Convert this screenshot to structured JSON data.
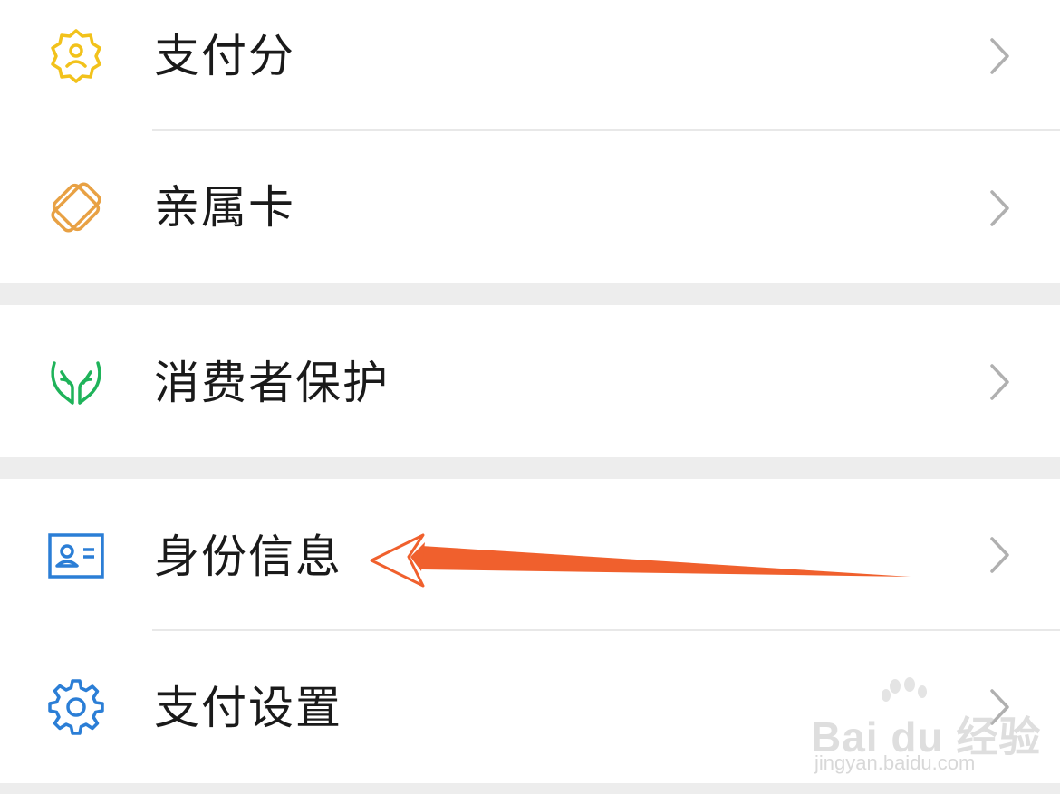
{
  "menu": {
    "items": [
      {
        "label": "支付分",
        "icon": "payscore-badge-icon",
        "color": "#f2c21b"
      },
      {
        "label": "亲属卡",
        "icon": "family-card-icon",
        "color": "#e8a144"
      },
      {
        "label": "消费者保护",
        "icon": "consumer-protection-hands-icon",
        "color": "#1fb35a"
      },
      {
        "label": "身份信息",
        "icon": "id-card-icon",
        "color": "#2b7ed6"
      },
      {
        "label": "支付设置",
        "icon": "gear-icon",
        "color": "#2b7ed6"
      }
    ]
  },
  "annotation": {
    "color": "#f0602d"
  },
  "watermark": {
    "logo": "Bai du 经验",
    "url": "jingyan.baidu.com"
  }
}
